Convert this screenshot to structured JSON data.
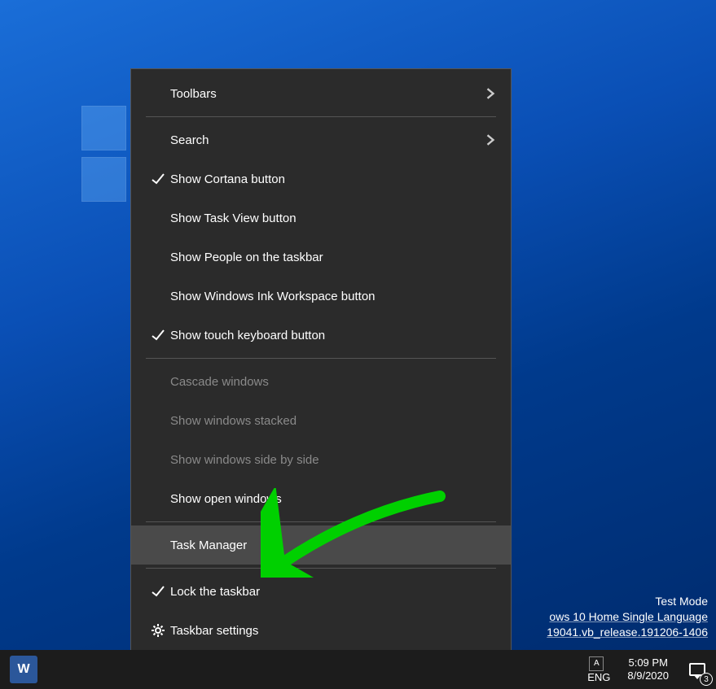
{
  "context_menu": {
    "toolbars": "Toolbars",
    "search": "Search",
    "show_cortana": "Show Cortana button",
    "show_taskview": "Show Task View button",
    "show_people": "Show People on the taskbar",
    "show_ink": "Show Windows Ink Workspace button",
    "show_touch_kb": "Show touch keyboard button",
    "cascade": "Cascade windows",
    "stacked": "Show windows stacked",
    "sidebyside": "Show windows side by side",
    "show_open": "Show open windows",
    "task_manager": "Task Manager",
    "lock_taskbar": "Lock the taskbar",
    "taskbar_settings": "Taskbar settings"
  },
  "watermark": {
    "line1": "Test Mode",
    "line2": "ows 10 Home Single Language",
    "line3": "19041.vb_release.191206-1406"
  },
  "taskbar": {
    "word_letter": "W",
    "lang": "ENG",
    "time": "5:09 PM",
    "date": "8/9/2020",
    "notification_count": "3"
  }
}
